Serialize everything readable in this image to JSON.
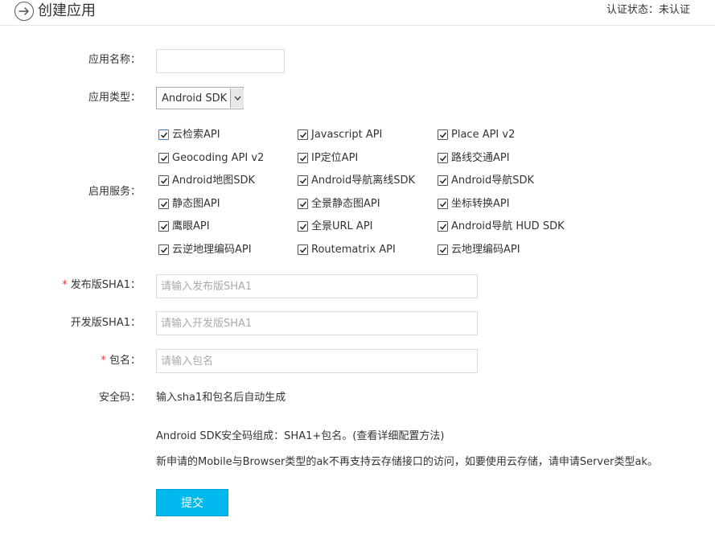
{
  "header": {
    "title": "创建应用",
    "auth_status": "认证状态：未认证",
    "back_icon": "arrow-right-circle-icon"
  },
  "form": {
    "app_name": {
      "label": "应用名称：",
      "value": ""
    },
    "app_type": {
      "label": "应用类型：",
      "selected": "Android SDK"
    },
    "services": {
      "label": "启用服务：",
      "items": [
        {
          "label": "云检索API",
          "checked": true
        },
        {
          "label": "Javascript API",
          "checked": true
        },
        {
          "label": "Place API v2",
          "checked": true
        },
        {
          "label": "Geocoding API v2",
          "checked": true
        },
        {
          "label": "IP定位API",
          "checked": true
        },
        {
          "label": "路线交通API",
          "checked": true
        },
        {
          "label": "Android地图SDK",
          "checked": true
        },
        {
          "label": "Android导航离线SDK",
          "checked": true
        },
        {
          "label": "Android导航SDK",
          "checked": true
        },
        {
          "label": "静态图API",
          "checked": true
        },
        {
          "label": "全景静态图API",
          "checked": true
        },
        {
          "label": "坐标转换API",
          "checked": true
        },
        {
          "label": "鹰眼API",
          "checked": true
        },
        {
          "label": "全景URL API",
          "checked": true
        },
        {
          "label": "Android导航 HUD SDK",
          "checked": true
        },
        {
          "label": "云逆地理编码API",
          "checked": true
        },
        {
          "label": "Routematrix API",
          "checked": true
        },
        {
          "label": "云地理编码API",
          "checked": true
        }
      ]
    },
    "release_sha1": {
      "required_mark": "*",
      "label": "发布版SHA1：",
      "placeholder": "请输入发布版SHA1"
    },
    "dev_sha1": {
      "label": "开发版SHA1：",
      "placeholder": "请输入开发版SHA1"
    },
    "package": {
      "required_mark": "*",
      "label": "包名：",
      "placeholder": "请输入包名"
    },
    "security_code": {
      "label": "安全码：",
      "value": "输入sha1和包名后自动生成"
    },
    "note_line1_prefix": "Android SDK安全码组成：SHA1+包名。",
    "note_line1_link": "(查看详细配置方法)",
    "note_line2": "新申请的Mobile与Browser类型的ak不再支持云存储接口的访问，如要使用云存储，请申请Server类型ak。",
    "submit_label": "提交"
  },
  "colors": {
    "accent": "#00b7ee",
    "required": "#e4393c"
  }
}
